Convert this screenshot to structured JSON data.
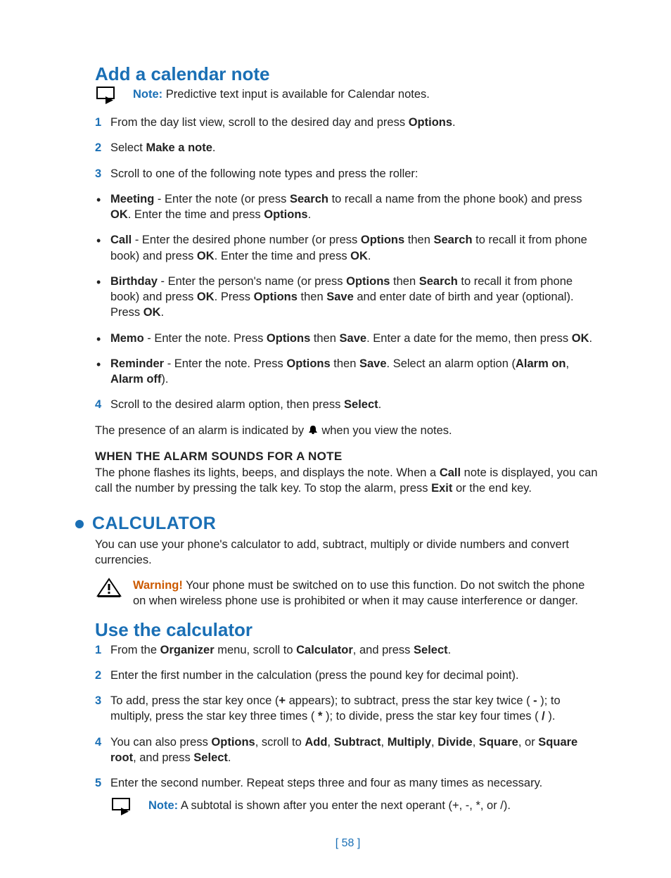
{
  "section1": {
    "title": "Add a calendar note",
    "note": {
      "label": "Note:",
      "text": " Predictive text input is available for Calendar notes."
    },
    "steps123": {
      "s1": {
        "pre": "From the day list view, scroll to the desired day and press ",
        "b1": "Options",
        "post": "."
      },
      "s2": {
        "pre": "Select ",
        "b1": "Make a note",
        "post": "."
      },
      "s3": {
        "text": "Scroll to one of the following note types and press the roller:"
      }
    },
    "bullets": {
      "meeting": {
        "b1": "Meeting",
        "t1": " - Enter the note (or press ",
        "b2": "Search",
        "t2": " to recall a name from the phone book) and press ",
        "b3": "OK",
        "t3": ". Enter the time and press ",
        "b4": "Options",
        "t4": "."
      },
      "call": {
        "b1": "Call",
        "t1": " - Enter the desired phone number (or press ",
        "b2": "Options",
        "t2": " then ",
        "b3": "Search",
        "t3": " to recall it from phone book) and press ",
        "b4": "OK",
        "t4": ". Enter the time and press ",
        "b5": "OK",
        "t5": "."
      },
      "birthday": {
        "b1": "Birthday",
        "t1": " - Enter the person's name (or press ",
        "b2": "Options",
        "t2": " then ",
        "b3": "Search",
        "t3": " to recall it from phone book) and press ",
        "b4": "OK",
        "t4": ". Press ",
        "b5": "Options",
        "t5": " then ",
        "b6": "Save",
        "t6": " and enter date of birth and year (optional). Press ",
        "b7": "OK",
        "t7": "."
      },
      "memo": {
        "b1": "Memo",
        "t1": " - Enter the note. Press ",
        "b2": "Options",
        "t2": " then ",
        "b3": "Save",
        "t3": ". Enter a date for the memo, then press ",
        "b4": "OK",
        "t4": "."
      },
      "reminder": {
        "b1": "Reminder",
        "t1": " - Enter the note. Press ",
        "b2": "Options",
        "t2": " then ",
        "b3": "Save",
        "t3": ". Select an alarm option (",
        "b4": "Alarm on",
        "t4": ", ",
        "b5": "Alarm off",
        "t5": ")."
      }
    },
    "step4": {
      "pre": "Scroll to the desired alarm option, then press ",
      "b1": "Select",
      "post": "."
    },
    "alarm_presence": {
      "pre": "The presence of an alarm is indicated by ",
      "post": " when you view the notes."
    },
    "subhead": "WHEN THE ALARM SOUNDS FOR A NOTE",
    "alarm_para": {
      "t1": "The phone flashes its lights, beeps, and displays the note. When a ",
      "b1": "Call",
      "t2": " note is displayed, you can call the number by pressing the talk key. To stop the alarm, press ",
      "b2": "Exit",
      "t3": " or the end key."
    }
  },
  "section2": {
    "title": "CALCULATOR",
    "intro": "You can use your phone's calculator to add, subtract, multiply or divide numbers and convert currencies.",
    "warning": {
      "label": "Warning!",
      "text": " Your phone must be switched on to use this function. Do not switch the phone on when wireless phone use is prohibited or when it may cause interference or danger."
    }
  },
  "section3": {
    "title": "Use the calculator",
    "steps": {
      "s1": {
        "t1": "From the ",
        "b1": "Organizer",
        "t2": " menu, scroll to ",
        "b2": "Calculator",
        "t3": ", and press ",
        "b3": "Select",
        "t4": "."
      },
      "s2": {
        "text": "Enter the first number in the calculation (press the pound key for decimal point)."
      },
      "s3": {
        "t1": "To add, press the star key once (",
        "b1": "+",
        "t2": " appears); to subtract, press the star key twice ( ",
        "b2": "-",
        "t3": " ); to multiply, press the star key three times ( ",
        "b3": "*",
        "t4": " ); to divide, press the star key four times ( ",
        "b4": "/",
        "t5": " )."
      },
      "s4": {
        "t1": "You can also press ",
        "b1": "Options",
        "t2": ", scroll to ",
        "b2": "Add",
        "t3": ", ",
        "b3": "Subtract",
        "t4": ", ",
        "b4": "Multiply",
        "t5": ", ",
        "b5": "Divide",
        "t6": ", ",
        "b6": "Square",
        "t7": ", or ",
        "b7": "Square root",
        "t8": ", and press ",
        "b8": "Select",
        "t9": "."
      },
      "s5": {
        "text": "Enter the second number. Repeat steps three and four as many times as necessary."
      }
    },
    "note": {
      "label": "Note:",
      "text": " A subtotal is shown after you enter the next operant (+, -, *, or /)."
    }
  },
  "footer": "[ 58 ]"
}
